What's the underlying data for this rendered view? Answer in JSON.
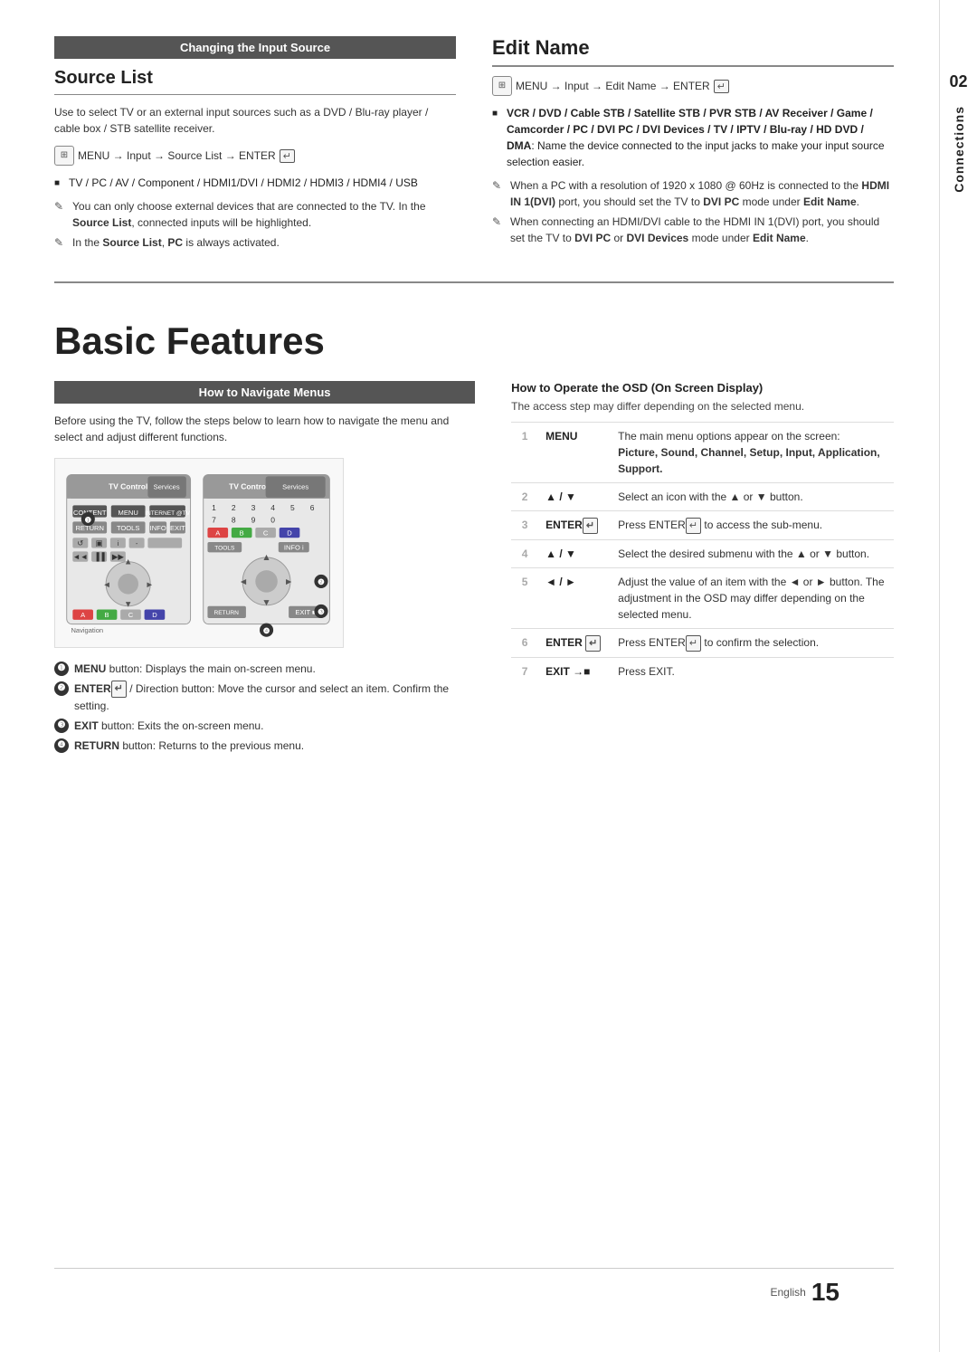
{
  "page": {
    "number": "15",
    "number_label": "English",
    "side_tab_number": "02",
    "side_tab_label": "Connections"
  },
  "top_left": {
    "section_header": "Changing the Input Source",
    "section_title": "Source List",
    "desc": "Use to select TV or an external input sources such as a DVD / Blu-ray player / cable box / STB satellite receiver.",
    "menu_path": "MENU → Input → Source List → ENTER",
    "bullet_label": "TV / PC / AV / Component / HDMI1/DVI / HDMI2 / HDMI3 / HDMI4 / USB",
    "notes": [
      "You can only choose external devices that are connected to the TV. In the Source List, connected inputs will be highlighted.",
      "In the Source List, PC is always activated."
    ]
  },
  "top_right": {
    "section_title": "Edit Name",
    "menu_path": "MENU → Input → Edit Name → ENTER",
    "bullet_text": "VCR / DVD / Cable STB / Satellite STB / PVR STB / AV Receiver / Game / Camcorder / PC / DVI PC / DVI Devices / TV / IPTV / Blu-ray / HD DVD / DMA: Name the device connected to the input jacks to make your input source selection easier.",
    "notes": [
      "When a PC with a resolution of 1920 x 1080 @ 60Hz is connected to the HDMI IN 1(DVI) port, you should set the TV to DVI PC mode under Edit Name.",
      "When connecting an HDMI/DVI cable to the HDMI IN 1(DVI) port, you should set the TV to DVI PC or DVI Devices mode under Edit Name."
    ]
  },
  "basic_features": {
    "title": "Basic Features",
    "nav_header": "How to Navigate Menus",
    "nav_desc": "Before using the TV, follow the steps below to learn how to navigate the menu and select and adjust different functions.",
    "numbered_notes": [
      "MENU button: Displays the main on-screen menu.",
      "ENTER  / Direction button: Move the cursor and select an item. Confirm the setting.",
      "EXIT button: Exits the on-screen menu.",
      "RETURN button: Returns to the previous menu."
    ],
    "osd_title": "How to Operate the OSD (On Screen Display)",
    "osd_subtitle": "The access step may differ depending on the selected menu.",
    "osd_steps": [
      {
        "num": "1",
        "label": "MENU",
        "desc": "The main menu options appear on the screen:",
        "desc2": "Picture, Sound, Channel, Setup, Input, Application, Support."
      },
      {
        "num": "2",
        "label": "▲ / ▼",
        "desc": "Select an icon with the ▲ or ▼ button.",
        "desc2": ""
      },
      {
        "num": "3",
        "label": "ENTER",
        "desc": "Press ENTER  to access the sub-menu.",
        "desc2": ""
      },
      {
        "num": "4",
        "label": "▲ / ▼",
        "desc": "Select the desired submenu with the ▲ or ▼ button.",
        "desc2": ""
      },
      {
        "num": "5",
        "label": "◄ / ►",
        "desc": "Adjust the value of an item with the ◄ or ► button. The adjustment in the OSD may differ depending on the selected menu.",
        "desc2": ""
      },
      {
        "num": "6",
        "label": "ENTER  ↵",
        "desc": "Press ENTER  to confirm the selection.",
        "desc2": ""
      },
      {
        "num": "7",
        "label": "EXIT →■",
        "desc": "Press EXIT.",
        "desc2": ""
      }
    ]
  }
}
